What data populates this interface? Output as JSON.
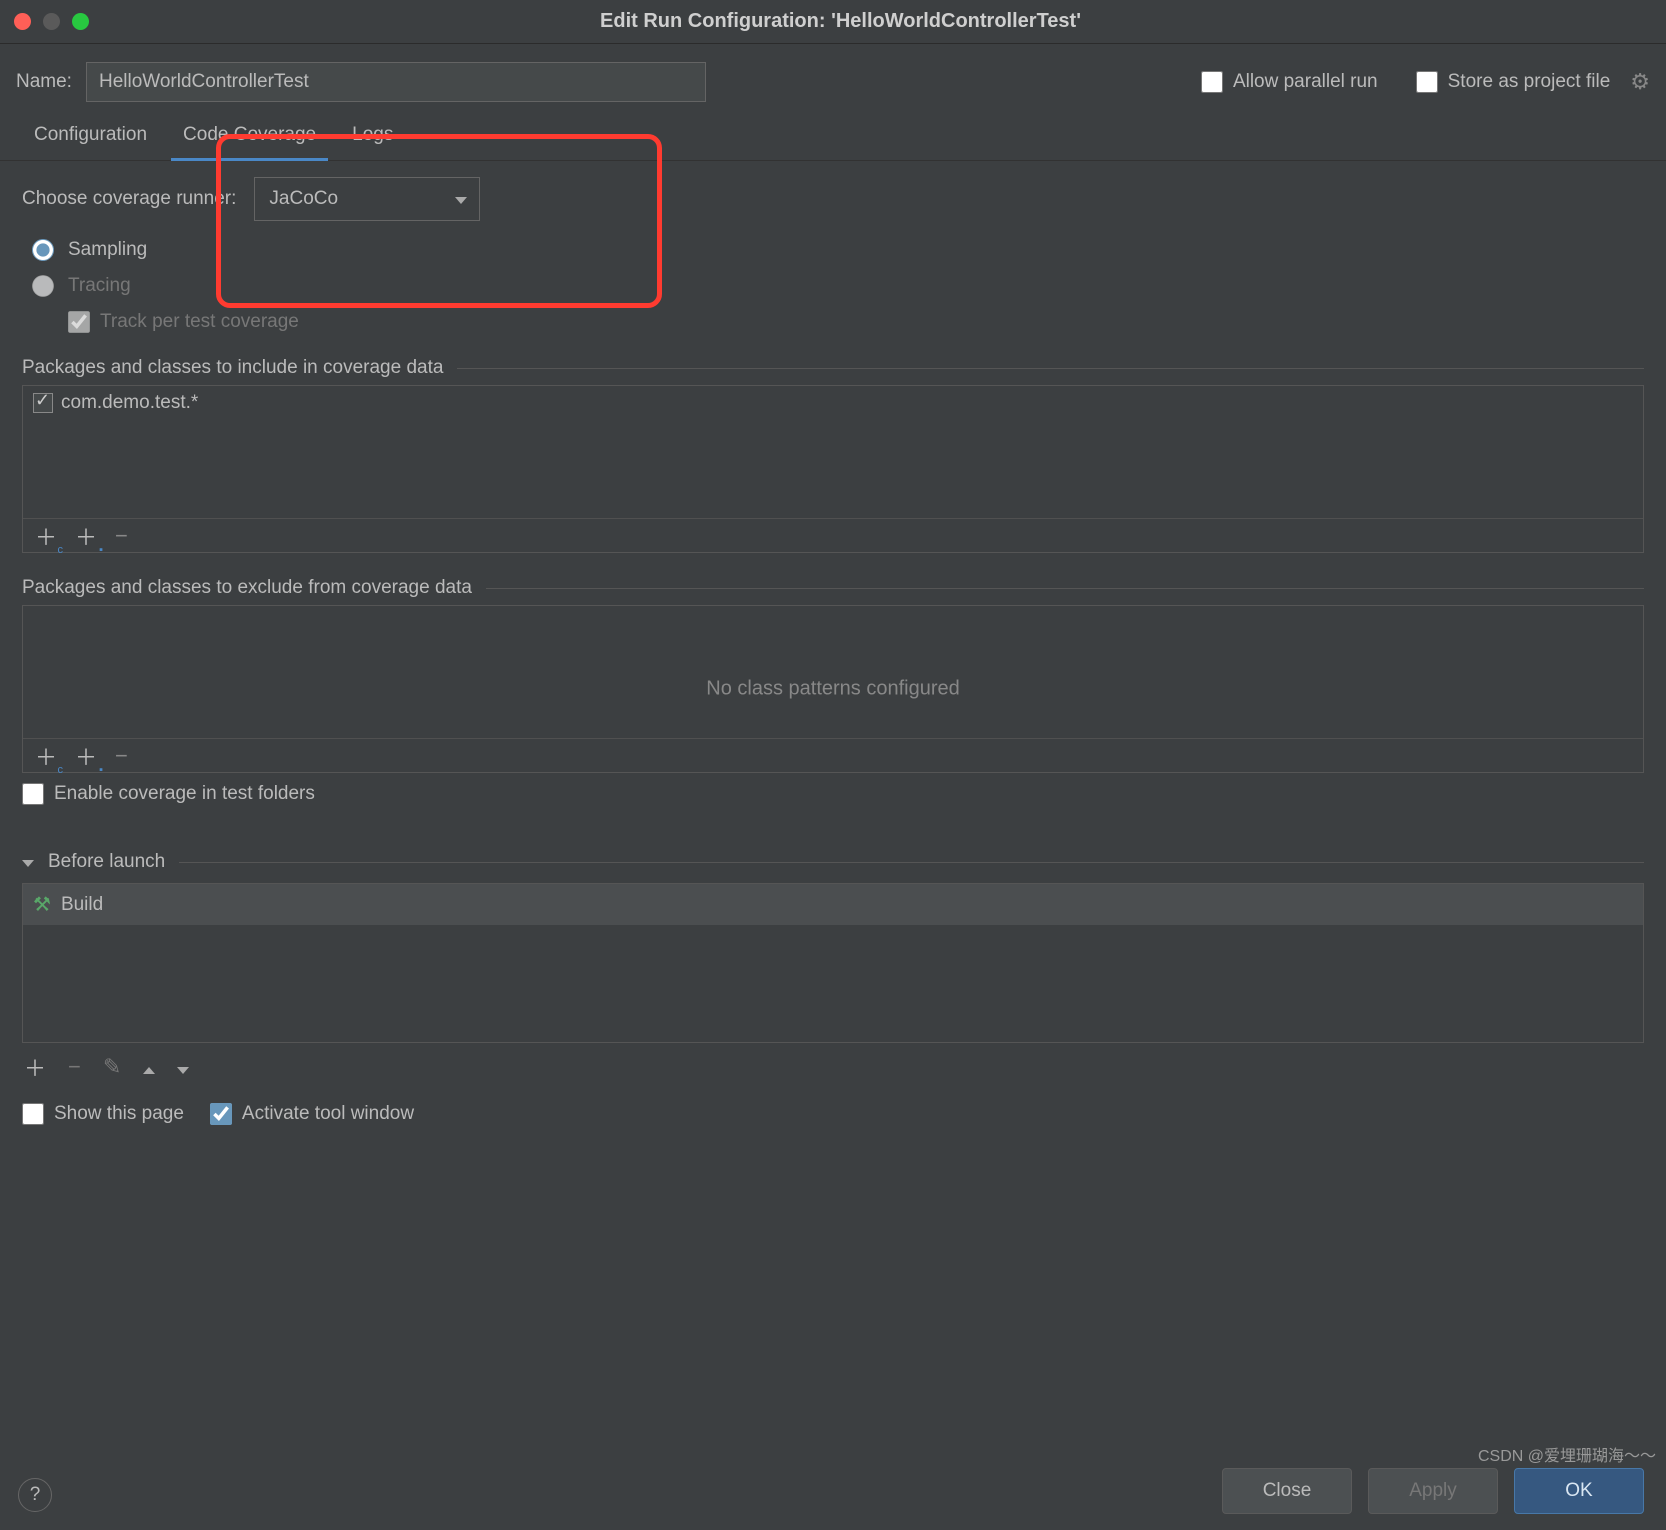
{
  "window": {
    "title": "Edit Run Configuration: 'HelloWorldControllerTest'"
  },
  "name_row": {
    "label": "Name:",
    "value": "HelloWorldControllerTest"
  },
  "options": {
    "allow_parallel_label": "Allow parallel run",
    "store_as_file_label": "Store as project file"
  },
  "tabs": {
    "configuration": "Configuration",
    "code_coverage": "Code Coverage",
    "logs": "Logs"
  },
  "coverage": {
    "runner_label": "Choose coverage runner:",
    "runner_value": "JaCoCo",
    "sampling": "Sampling",
    "tracing": "Tracing",
    "track_per_test": "Track per test coverage"
  },
  "include": {
    "header": "Packages and classes to include in coverage data",
    "items": [
      "com.demo.test.*"
    ]
  },
  "exclude": {
    "header": "Packages and classes to exclude from coverage data",
    "empty_text": "No class patterns configured"
  },
  "enable_test_folders": "Enable coverage in test folders",
  "before_launch": {
    "header": "Before launch",
    "items": [
      "Build"
    ]
  },
  "footer": {
    "show_this_page": "Show this page",
    "activate_tool_window": "Activate tool window"
  },
  "buttons": {
    "close": "Close",
    "apply": "Apply",
    "ok": "OK"
  },
  "watermark": "CSDN @爱埋珊瑚海～～"
}
